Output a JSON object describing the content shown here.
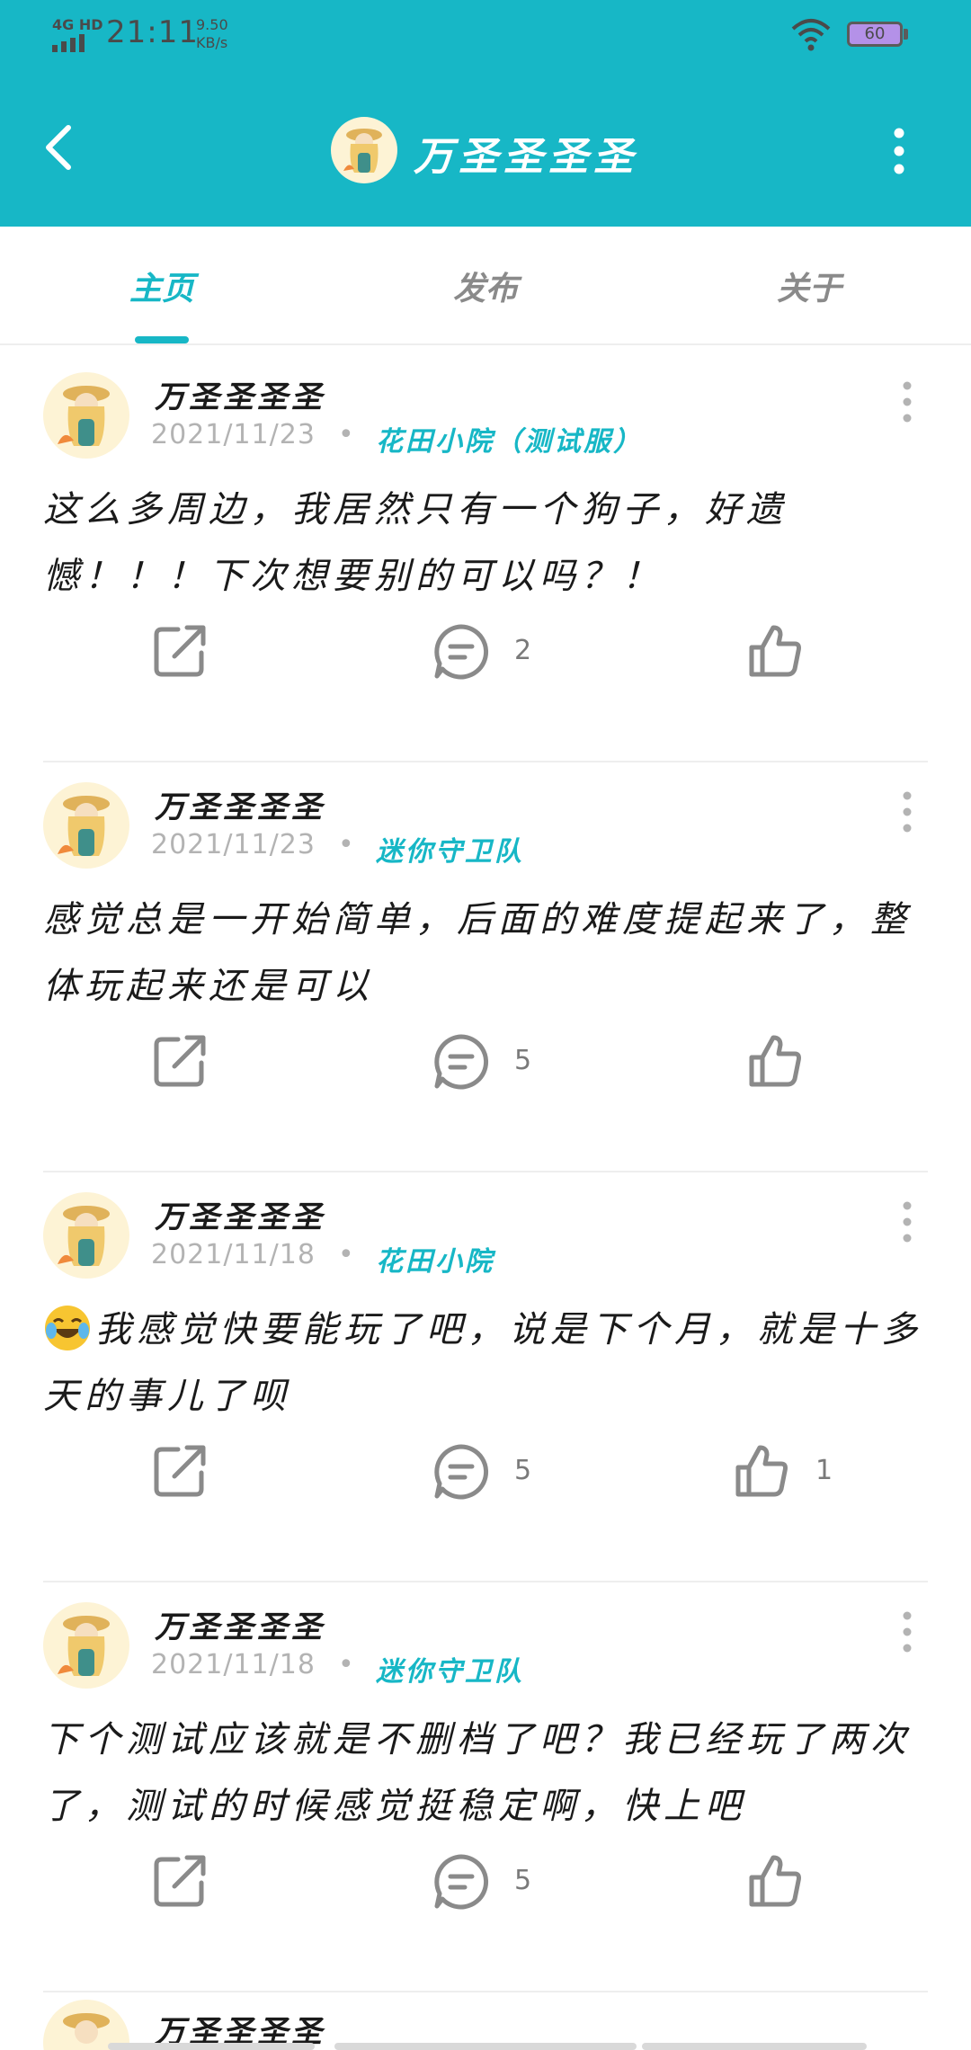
{
  "status_bar": {
    "network": "4G HD",
    "time": "21:11",
    "speed_value": "9.50",
    "speed_unit": "KB/s",
    "battery": "60",
    "icons": [
      "signal-icon",
      "wifi-icon",
      "battery-icon"
    ]
  },
  "header": {
    "title": "万圣圣圣圣",
    "icons": [
      "back-arrow-icon",
      "more-vertical-icon"
    ]
  },
  "tabs": [
    {
      "label": "主页",
      "active": true
    },
    {
      "label": "发布",
      "active": false
    },
    {
      "label": "关于",
      "active": false
    }
  ],
  "colors": {
    "accent": "#17b7c6",
    "text": "#1a1a1a",
    "muted": "#b3b3b3"
  },
  "posts": [
    {
      "author": "万圣圣圣圣",
      "date": "2021/11/23",
      "game": "花田小院（测试服）",
      "content": "这么多周边，我居然只有一个狗子，好遗憾！！！下次想要别的可以吗？！",
      "comments": "2",
      "likes": ""
    },
    {
      "author": "万圣圣圣圣",
      "date": "2021/11/23",
      "game": "迷你守卫队",
      "content": "感觉总是一开始简单，后面的难度提起来了，整体玩起来还是可以",
      "comments": "5",
      "likes": ""
    },
    {
      "author": "万圣圣圣圣",
      "date": "2021/11/18",
      "game": "花田小院",
      "content": "我感觉快要能玩了吧，说是下个月，就是十多天的事儿了呗",
      "comments": "5",
      "likes": "1"
    },
    {
      "author": "万圣圣圣圣",
      "date": "2021/11/18",
      "game": "迷你守卫队",
      "content": "下个测试应该就是不删档了吧？我已经玩了两次了，测试的时候感觉挺稳定啊，快上吧",
      "comments": "5",
      "likes": ""
    },
    {
      "author": "万圣圣圣圣"
    }
  ],
  "separator": "•"
}
